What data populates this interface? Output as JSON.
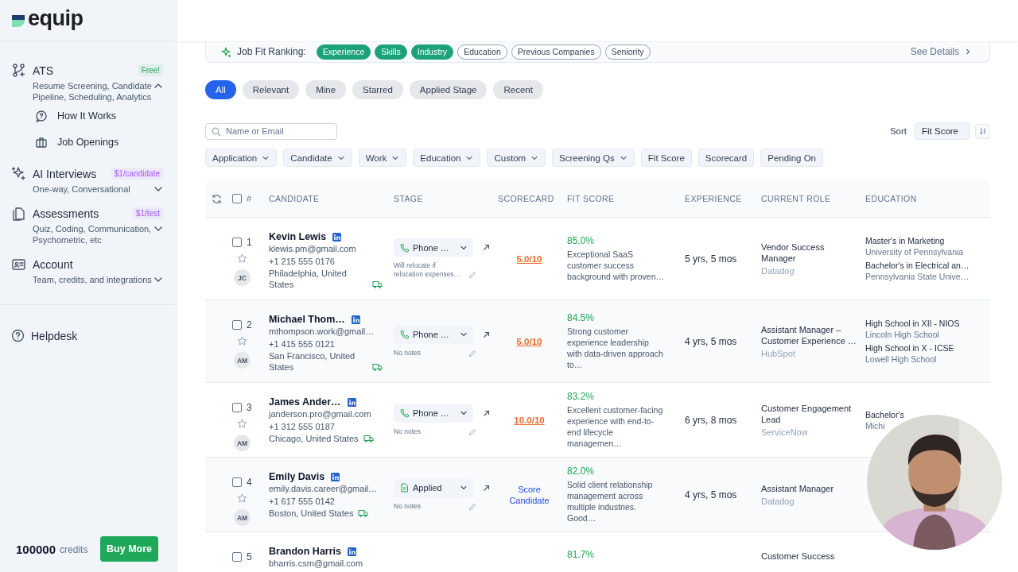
{
  "sidebar": {
    "logo_text": "equip",
    "sections": [
      {
        "title": "ATS",
        "badge": {
          "text": "Free!",
          "color": "#22a355"
        },
        "subtitle": "Resume Screening, Candidate Pipeline, Scheduling, Analytics",
        "expanded": true,
        "children": [
          {
            "label": "How It Works"
          },
          {
            "label": "Job Openings"
          }
        ]
      },
      {
        "title": "AI Interviews",
        "badge": {
          "text": "$1/candidate",
          "color": "#a855f7"
        },
        "subtitle": "One-way, Conversational",
        "expanded": false
      },
      {
        "title": "Assessments",
        "badge": {
          "text": "$1/test",
          "color": "#a855f7"
        },
        "subtitle": "Quiz, Coding, Communication, Psychometric, etc",
        "expanded": false
      },
      {
        "title": "Account",
        "subtitle": "Team, credits, and integrations",
        "expanded": false
      }
    ],
    "helpdesk": "Helpdesk",
    "credits": {
      "amount": "100000",
      "unit": "credits"
    },
    "buy_button": "Buy More"
  },
  "job_fit": {
    "label": "Job Fit Ranking:",
    "chips": [
      {
        "label": "Experience",
        "selected": true
      },
      {
        "label": "Skills",
        "selected": true
      },
      {
        "label": "Industry",
        "selected": true
      },
      {
        "label": "Education",
        "selected": false
      },
      {
        "label": "Previous Companies",
        "selected": false
      },
      {
        "label": "Seniority",
        "selected": false
      }
    ],
    "details_link": "See Details"
  },
  "tabs": [
    {
      "label": "All",
      "selected": true
    },
    {
      "label": "Relevant",
      "selected": false
    },
    {
      "label": "Mine",
      "selected": false
    },
    {
      "label": "Starred",
      "selected": false
    },
    {
      "label": "Applied Stage",
      "selected": false
    },
    {
      "label": "Recent",
      "selected": false
    }
  ],
  "search": {
    "placeholder": "Name or Email"
  },
  "sort": {
    "label": "Sort",
    "value": "Fit Score"
  },
  "filters": [
    {
      "label": "Application",
      "has_menu": true
    },
    {
      "label": "Candidate",
      "has_menu": true
    },
    {
      "label": "Work",
      "has_menu": true
    },
    {
      "label": "Education",
      "has_menu": true
    },
    {
      "label": "Custom",
      "has_menu": true
    },
    {
      "label": "Screening Qs",
      "has_menu": true
    },
    {
      "label": "Fit Score",
      "has_menu": false
    },
    {
      "label": "Scorecard",
      "has_menu": false
    },
    {
      "label": "Pending On",
      "has_menu": false
    }
  ],
  "table": {
    "select_all_checked": false,
    "number_header": "#",
    "columns": [
      "CANDIDATE",
      "STAGE",
      "SCORECARD",
      "FIT SCORE",
      "EXPERIENCE",
      "CURRENT ROLE",
      "EDUCATION"
    ],
    "rows": [
      {
        "checked": false,
        "number": "1",
        "starred": false,
        "initials": "JC",
        "name": "Kevin Lewis",
        "email": "klewis.pm@gmail.com",
        "phone": "+1 215 555 0176",
        "location": "Philadelphia, United States",
        "stage": {
          "kind": "phone",
          "label": "Phone …"
        },
        "notes": "Will relocate if relocation expenses…",
        "scorecard": {
          "kind": "score",
          "text": "5.0/10"
        },
        "fit": "85.0%",
        "summary": "Exceptional SaaS customer success background with proven…",
        "experience": "5 yrs, 5 mos",
        "role": "Vendor Success Manager",
        "company": "Datadog",
        "education": [
          {
            "degree": "Master's in Marketing",
            "school": "University of Pennsylvania"
          },
          {
            "degree": "Bachelor's in Electrical an…",
            "school": "Pennsylvania State Unive…"
          }
        ]
      },
      {
        "checked": false,
        "number": "2",
        "starred": false,
        "initials": "AM",
        "name": "Michael Thom…",
        "email": "mthompson.work@gmail…",
        "phone": "+1 415 555 0121",
        "location": "San Francisco, United States",
        "stage": {
          "kind": "phone",
          "label": "Phone …"
        },
        "notes": "No notes",
        "scorecard": {
          "kind": "score",
          "text": "5.0/10"
        },
        "fit": "84.5%",
        "summary": "Strong customer experience leadership with data-driven approach to…",
        "experience": "4 yrs, 5 mos",
        "role": "Assistant Manager – Customer Experience …",
        "company": "HubSpot",
        "education": [
          {
            "degree": "High School in XII - NIOS",
            "school": "Lincoln High School"
          },
          {
            "degree": "High School in X - ICSE",
            "school": "Lowell High School"
          }
        ]
      },
      {
        "checked": false,
        "number": "3",
        "starred": false,
        "initials": "AM",
        "name": "James Ander…",
        "email": "janderson.pro@gmail.com",
        "phone": "+1 312 555 0187",
        "location": "Chicago, United States",
        "stage": {
          "kind": "phone",
          "label": "Phone …"
        },
        "notes": "No notes",
        "scorecard": {
          "kind": "score",
          "text": "10.0/10"
        },
        "fit": "83.2%",
        "summary": "Excellent customer-facing experience with end-to-end lifecycle managemen…",
        "experience": "6 yrs, 8 mos",
        "role": "Customer Engagement Lead",
        "company": "ServiceNow",
        "education": [
          {
            "degree": "Bachelor's",
            "school": "Michi"
          }
        ]
      },
      {
        "checked": false,
        "number": "4",
        "starred": false,
        "initials": "AM",
        "name": "Emily Davis",
        "email": "emily.davis.career@gmail…",
        "phone": "+1 617 555 0142",
        "location": "Boston, United States",
        "stage": {
          "kind": "applied",
          "label": "Applied"
        },
        "notes": "No notes",
        "scorecard": {
          "kind": "link",
          "text": "Score Candidate"
        },
        "fit": "82.0%",
        "summary": "Solid client relationship management across multiple industries. Good…",
        "experience": "4 yrs, 5 mos",
        "role": "Assistant Manager",
        "company": "Datadog"
      },
      {
        "checked": false,
        "number": "5",
        "name": "Brandon Harris",
        "email": "bharris.csm@gmail.com",
        "fit": "81.7%",
        "role": "Customer Success"
      }
    ]
  }
}
